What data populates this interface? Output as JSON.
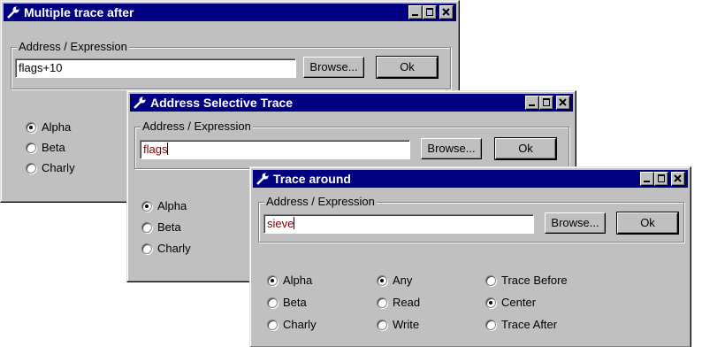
{
  "window1": {
    "title": "Multiple trace after",
    "group_label": "Address / Expression",
    "input_value": "flags+10",
    "browse_label": "Browse...",
    "ok_label": "Ok",
    "options": [
      "Alpha",
      "Beta",
      "Charly"
    ]
  },
  "window2": {
    "title": "Address Selective Trace",
    "group_label": "Address / Expression",
    "input_value": "flags",
    "browse_label": "Browse...",
    "ok_label": "Ok",
    "options": [
      "Alpha",
      "Beta",
      "Charly"
    ]
  },
  "window3": {
    "title": "Trace around",
    "group_label": "Address / Expression",
    "input_value": "sieve",
    "browse_label": "Browse...",
    "ok_label": "Ok",
    "col1": [
      "Alpha",
      "Beta",
      "Charly"
    ],
    "col2": [
      "Any",
      "Read",
      "Write"
    ],
    "col3": [
      "Trace Before",
      "Center",
      "Trace After"
    ]
  },
  "icons": {
    "title_icon": "wrench-icon",
    "minimize": "minimize-icon",
    "maximize": "maximize-icon",
    "close": "close-icon"
  },
  "selected": {
    "window1": "Alpha",
    "window2": "Alpha",
    "window3_col1": "Alpha",
    "window3_col2": "Any",
    "window3_col3": "Center"
  }
}
